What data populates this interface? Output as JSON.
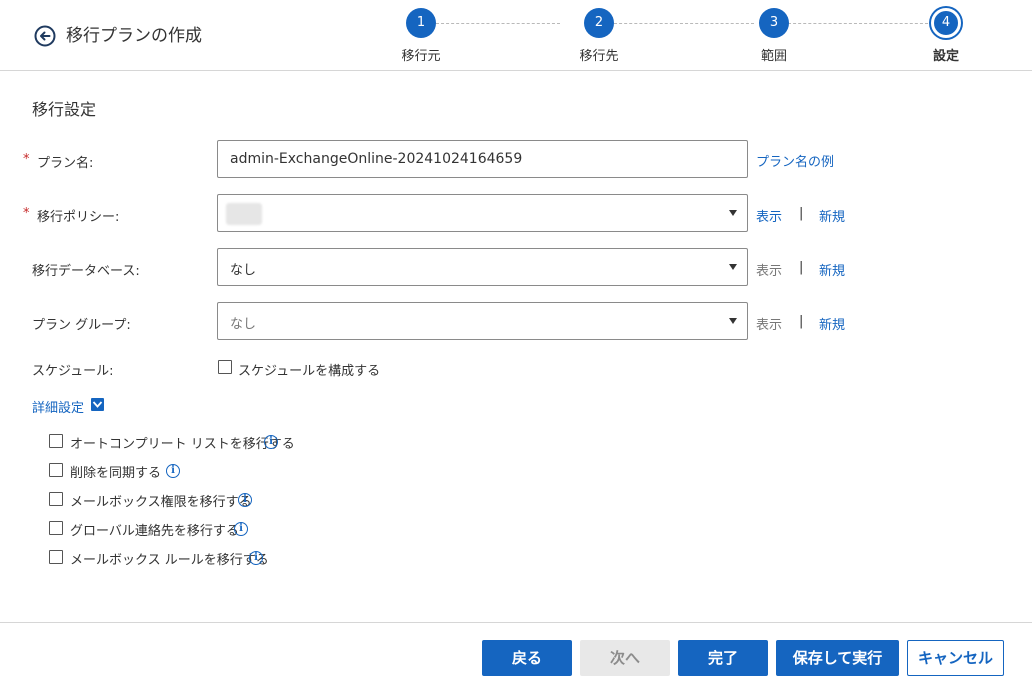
{
  "header": {
    "title": "移行プランの作成",
    "steps": [
      {
        "number": "1",
        "label": "移行元"
      },
      {
        "number": "2",
        "label": "移行先"
      },
      {
        "number": "3",
        "label": "範囲"
      },
      {
        "number": "4",
        "label": "設定"
      }
    ],
    "active_step": 4
  },
  "section": {
    "title": "移行設定"
  },
  "form": {
    "required_mark": "*",
    "plan_name": {
      "label": "プラン名:",
      "value": "admin-ExchangeOnline-20241024164659",
      "link": "プラン名の例"
    },
    "policy": {
      "label": "移行ポリシー:",
      "value": "",
      "view": "表示",
      "new": "新規"
    },
    "database": {
      "label": "移行データベース:",
      "value": "なし",
      "view": "表示",
      "new": "新規"
    },
    "group": {
      "label": "プラン グループ:",
      "value": "なし",
      "view": "表示",
      "new": "新規"
    },
    "separator": "|",
    "schedule": {
      "label": "スケジュール:",
      "checkbox_label": "スケジュールを構成する",
      "checked": false
    }
  },
  "advanced": {
    "toggle_label": "詳細設定",
    "expanded": true,
    "options": [
      {
        "label": "オートコンプリート リストを移行する",
        "checked": false
      },
      {
        "label": "削除を同期する",
        "checked": false
      },
      {
        "label": "メールボックス権限を移行する",
        "checked": false
      },
      {
        "label": "グローバル連絡先を移行する",
        "checked": false
      },
      {
        "label": "メールボックス ルールを移行する",
        "checked": false
      }
    ]
  },
  "footer": {
    "back": "戻る",
    "next": "次へ",
    "finish": "完了",
    "save_run": "保存して実行",
    "cancel": "キャンセル"
  },
  "colors": {
    "accent": "#1565c0",
    "required": "#c62828",
    "disabled": "#e8e8e8"
  },
  "icons": {
    "back": "arrow-left-circle-icon",
    "info": "info-icon",
    "chevron": "chevron-down-icon",
    "caret": "caret-down-icon"
  }
}
